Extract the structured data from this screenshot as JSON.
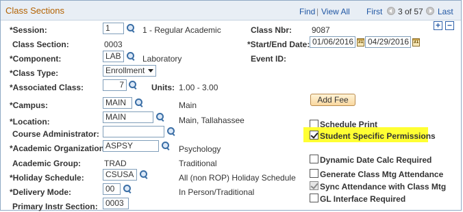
{
  "header": {
    "title": "Class Sections",
    "find": "Find",
    "sep": "|",
    "view_all": "View All",
    "first": "First",
    "counter": "3 of 57",
    "last": "Last"
  },
  "controls": {
    "add": "+",
    "remove": "−"
  },
  "fields": {
    "session": {
      "label": "*Session:",
      "value": "1",
      "desc": "1 - Regular Academic"
    },
    "class_section": {
      "label": "Class Section:",
      "value": "0003"
    },
    "component": {
      "label": "*Component:",
      "value": "LAB",
      "desc": "Laboratory"
    },
    "class_type": {
      "label": "*Class Type:",
      "value": "Enrollment"
    },
    "associated_class": {
      "label": "*Associated Class:",
      "value": "7",
      "units_label": "Units:",
      "units_value": "1.00 - 3.00"
    },
    "campus": {
      "label": "*Campus:",
      "value": "MAIN",
      "desc": "Main"
    },
    "location": {
      "label": "*Location:",
      "value": "MAIN",
      "desc": "Main, Tallahassee"
    },
    "course_admin": {
      "label": "Course Administrator:",
      "value": ""
    },
    "academic_org": {
      "label": "*Academic Organization:",
      "value": "ASPSY",
      "desc": "Psychology"
    },
    "academic_group": {
      "label": "Academic Group:",
      "value": "TRAD",
      "desc": "Traditional"
    },
    "holiday_schedule": {
      "label": "*Holiday Schedule:",
      "value": "CSUSA",
      "desc": "All (non ROP) Holiday Schedule"
    },
    "delivery_mode": {
      "label": "*Delivery Mode:",
      "value": "00",
      "desc": "In Person/Traditional"
    },
    "primary_instr": {
      "label": "Primary Instr Section:",
      "value": "0003"
    },
    "class_nbr": {
      "label": "Class Nbr:",
      "value": "9087"
    },
    "start_end": {
      "label": "*Start/End Date:",
      "start": "01/06/2016",
      "end": "04/29/2016"
    },
    "event_id": {
      "label": "Event ID:"
    }
  },
  "buttons": {
    "add_fee": "Add Fee"
  },
  "checkboxes": {
    "schedule_print": "Schedule Print",
    "student_specific": "Student Specific Permissions",
    "dynamic_date": "Dynamic Date Calc Required",
    "generate_mtg": "Generate Class Mtg Attendance",
    "sync_attendance": "Sync Attendance with Class Mtg",
    "gl_interface": "GL Interface Required"
  },
  "colors": {
    "title": "#b36200",
    "link": "#1f56a3",
    "highlight": "#ffff33"
  }
}
